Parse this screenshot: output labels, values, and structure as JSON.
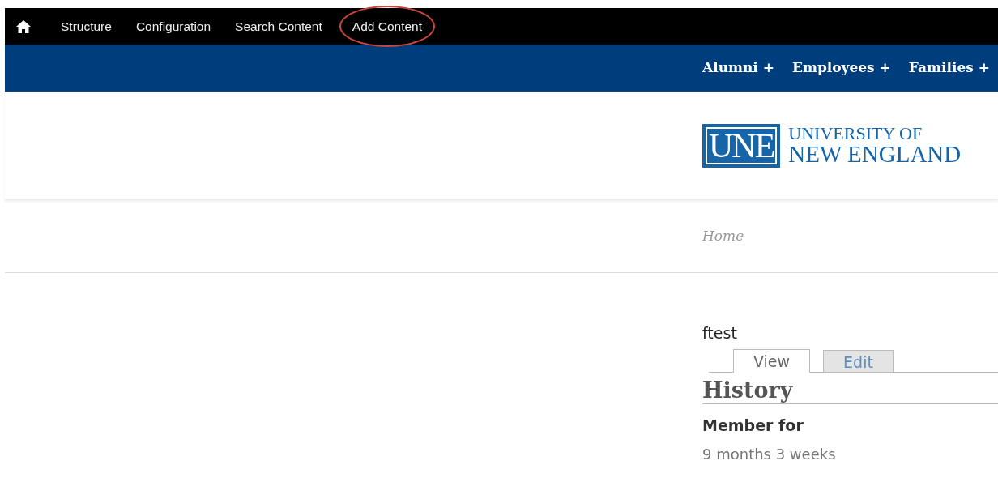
{
  "admin_menu": [
    {
      "label": "Structure",
      "circled": false
    },
    {
      "label": "Configuration",
      "circled": false
    },
    {
      "label": "Search Content",
      "circled": false
    },
    {
      "label": "Add Content",
      "circled": true
    }
  ],
  "audience_menu": [
    "Alumni +",
    "Employees +",
    "Families +"
  ],
  "logo": {
    "mark": "UNE",
    "line_1": "UNIVERSITY OF",
    "line_2": "NEW ENGLAND"
  },
  "breadcrumb": "Home",
  "user": {
    "name": "ftest",
    "tabs": [
      {
        "label": "View",
        "selected": true
      },
      {
        "label": "Edit",
        "selected": false
      }
    ],
    "section_title": "History",
    "field_label": "Member for",
    "field_value": "9 months 3 weeks"
  }
}
